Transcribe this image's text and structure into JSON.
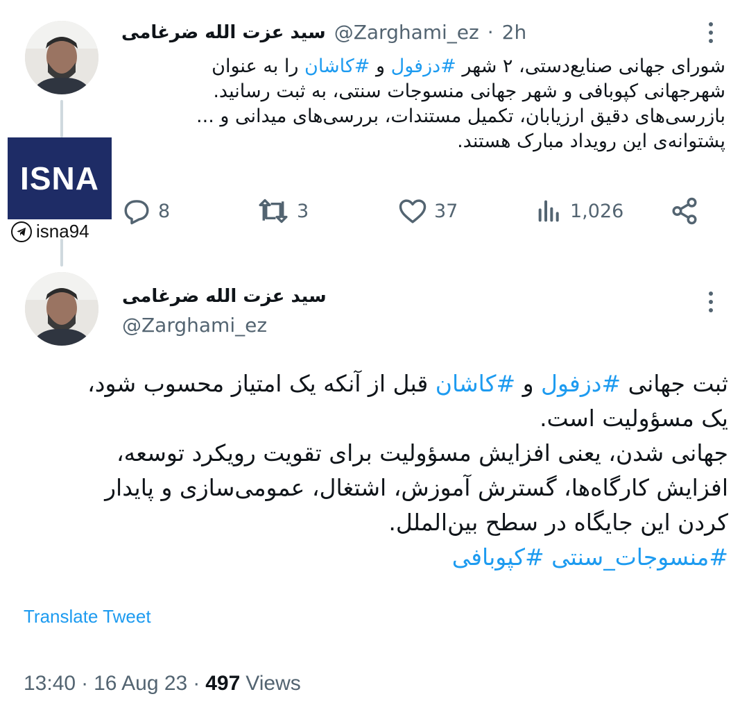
{
  "tweet1": {
    "author_name": "سید عزت الله ضرغامی",
    "handle": "@Zarghami_ez",
    "separator": "·",
    "time": "2h",
    "lines": [
      [
        {
          "t": "شورای جهانی صنایع‌دستی، ۲ شهر "
        },
        {
          "t": "#دزفول",
          "h": true
        },
        {
          "t": " و "
        },
        {
          "t": "#کاشان",
          "h": true
        },
        {
          "t": " را به عنوان"
        }
      ],
      [
        {
          "t": "شهرجهانی کپوبافی و شهر جهانی منسوجات سنتی، به ثبت رسانید."
        }
      ],
      [
        {
          "t": "بازرسی‌های دقیق ارزیابان، تکمیل مستندات، بررسی‌های میدانی و ..."
        }
      ],
      [
        {
          "t": "پشتوانه‌ی این رویداد مبارک هستند."
        }
      ]
    ],
    "actions": {
      "reply_count": "8",
      "retweet_count": "3",
      "like_count": "37",
      "views_count": "1,026"
    }
  },
  "watermark": {
    "logo_text": "ISNA",
    "channel": "isna94"
  },
  "tweet2": {
    "author_name": "سید عزت الله ضرغامی",
    "handle": "@Zarghami_ez",
    "lines": [
      [
        {
          "t": "ثبت جهانی "
        },
        {
          "t": "#دزفول",
          "h": true
        },
        {
          "t": " و "
        },
        {
          "t": "#کاشان",
          "h": true
        },
        {
          "t": " قبل از آنکه یک امتیاز محسوب شود،"
        }
      ],
      [
        {
          "t": "یک مسؤولیت است."
        }
      ],
      [
        {
          "t": "جهانی شدن، یعنی افزایش مسؤولیت برای تقویت رویکرد توسعه،"
        }
      ],
      [
        {
          "t": "افزایش کارگاه‌ها، گسترش آموزش، اشتغال، عمومی‌سازی و پایدار"
        }
      ],
      [
        {
          "t": "کردن این جایگاه در سطح بین‌الملل."
        }
      ],
      [
        {
          "t": "#منسوجات_سنتی #کپوبافی",
          "h": true
        }
      ]
    ],
    "translate_label": "Translate Tweet",
    "time": "13:40",
    "date": "16 Aug 23",
    "dot": "·",
    "views_count": "497",
    "views_label": "Views"
  },
  "colors": {
    "accent": "#1d9bf0",
    "muted": "#536471",
    "text": "#0f1419",
    "isna_blue": "#1e2c66"
  },
  "icons": [
    "more-vertical-icon",
    "reply-icon",
    "retweet-icon",
    "like-icon",
    "views-icon",
    "share-icon",
    "telegram-icon"
  ]
}
